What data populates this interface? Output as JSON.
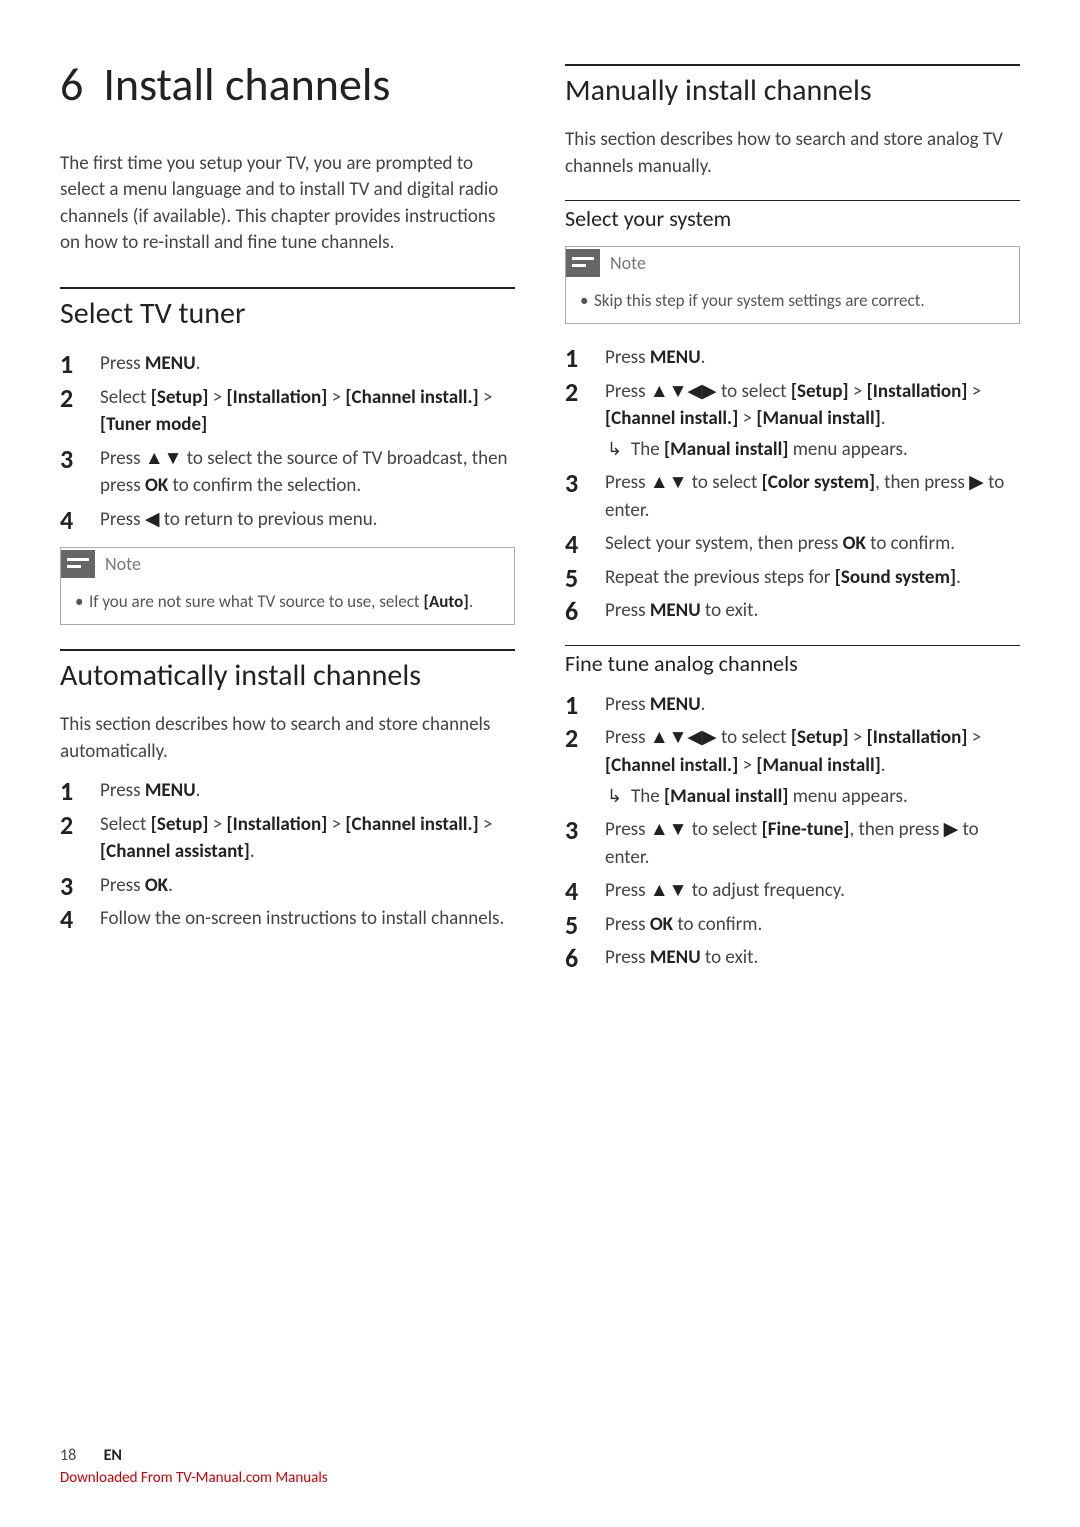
{
  "chapter": {
    "number": "6",
    "title": "Install channels"
  },
  "intro": "The first time you setup your TV, you are prompted to select a menu language and to install TV and digital radio channels (if available). This chapter provides instructions on how to re-install and fine tune channels.",
  "tuner": {
    "heading": "Select TV tuner",
    "steps": {
      "s1a": "Press ",
      "s1b": "MENU",
      "s1c": ".",
      "s2a": "Select ",
      "s2b": "[Setup]",
      "s2c": " > ",
      "s2d": "[Installation]",
      "s2e": " > ",
      "s2f": "[Channel install.]",
      "s2g": " > ",
      "s2h": "[Tuner mode]",
      "s3a": "Press ",
      "s3arrows": "▲▼",
      "s3b": " to select the source of TV broadcast, then press ",
      "s3c": "OK",
      "s3d": " to confirm the selection.",
      "s4a": "Press ",
      "s4arrow": "◀",
      "s4b": " to return to previous menu."
    },
    "note": {
      "label": "Note",
      "body_a": "If you are not sure what TV source to use, select ",
      "body_b": "[Auto]",
      "body_c": "."
    }
  },
  "auto": {
    "heading": "Automatically install channels",
    "intro": "This section describes how to search and store channels automatically.",
    "steps": {
      "s1a": "Press ",
      "s1b": "MENU",
      "s1c": ".",
      "s2a": "Select ",
      "s2b": "[Setup]",
      "s2c": " > ",
      "s2d": "[Installation]",
      "s2e": " > ",
      "s2f": "[Channel install.]",
      "s2g": " > ",
      "s2h": "[Channel assistant]",
      "s2i": ".",
      "s3a": "Press ",
      "s3b": "OK",
      "s3c": ".",
      "s4": "Follow the on-screen instructions to install channels."
    }
  },
  "manual": {
    "heading": "Manually install channels",
    "intro": "This section describes how to search and store analog TV channels manually.",
    "system": {
      "heading": "Select your system",
      "note": {
        "label": "Note",
        "body": "Skip this step if your system settings are correct."
      },
      "steps": {
        "s1a": "Press ",
        "s1b": "MENU",
        "s1c": ".",
        "s2a": "Press ",
        "s2arrows": "▲▼◀▶",
        "s2b": " to select ",
        "s2c": "[Setup]",
        "s2d": " > ",
        "s2e": "[Installation]",
        "s2f": " > ",
        "s2g": "[Channel install.]",
        "s2h": " > ",
        "s2i": "[Manual install]",
        "s2j": ".",
        "s2ra": "The ",
        "s2rb": "[Manual install]",
        "s2rc": " menu appears.",
        "s3a": "Press ",
        "s3arrows": "▲▼",
        "s3b": " to select ",
        "s3c": "[Color system]",
        "s3d": ", then press ",
        "s3arrow": "▶",
        "s3e": " to enter.",
        "s4a": "Select your system, then press ",
        "s4b": "OK",
        "s4c": " to confirm.",
        "s5a": "Repeat the previous steps for ",
        "s5b": "[Sound system]",
        "s5c": ".",
        "s6a": "Press ",
        "s6b": "MENU",
        "s6c": " to exit."
      }
    },
    "finetune": {
      "heading": "Fine tune analog channels",
      "steps": {
        "s1a": "Press ",
        "s1b": "MENU",
        "s1c": ".",
        "s2a": "Press ",
        "s2arrows": "▲▼◀▶",
        "s2b": " to select ",
        "s2c": "[Setup]",
        "s2d": " > ",
        "s2e": "[Installation]",
        "s2f": " > ",
        "s2g": "[Channel install.]",
        "s2h": " > ",
        "s2i": "[Manual install]",
        "s2j": ".",
        "s2ra": "The ",
        "s2rb": "[Manual install]",
        "s2rc": " menu appears.",
        "s3a": "Press ",
        "s3arrows": "▲▼",
        "s3b": " to select ",
        "s3c": "[Fine-tune]",
        "s3d": ", then press ",
        "s3arrow": "▶",
        "s3e": " to enter.",
        "s4a": "Press ",
        "s4arrows": "▲▼",
        "s4b": " to adjust frequency.",
        "s5a": "Press ",
        "s5b": "OK",
        "s5c": " to confirm.",
        "s6a": "Press ",
        "s6b": "MENU",
        "s6c": " to exit."
      }
    }
  },
  "footer": {
    "page": "18",
    "lang": "EN",
    "download": "Downloaded From TV-Manual.com Manuals"
  }
}
